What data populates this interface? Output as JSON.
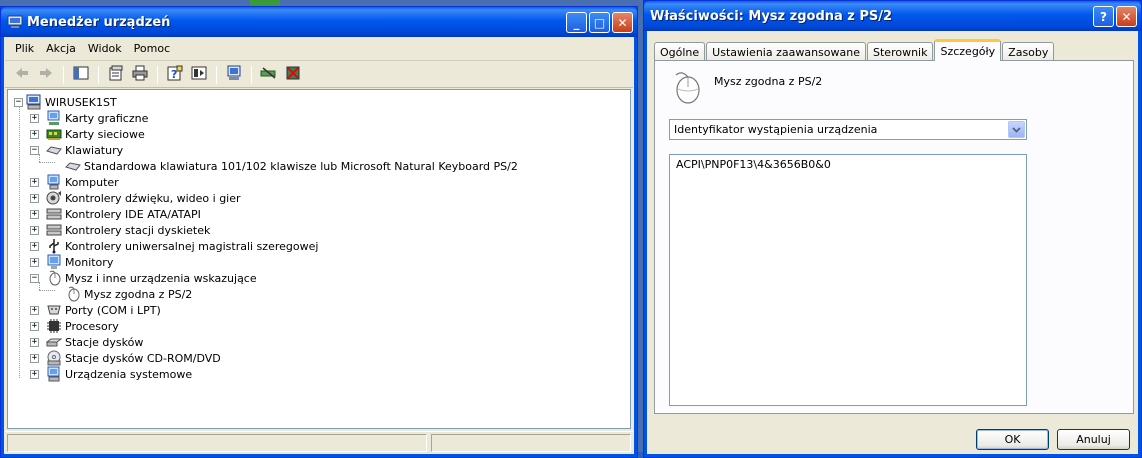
{
  "device_manager": {
    "title": "Menedżer urządzeń",
    "menu": [
      "Plik",
      "Akcja",
      "Widok",
      "Pomoc"
    ],
    "toolbar_icons": [
      "back-icon",
      "forward-icon",
      "up-level-icon",
      "properties-icon",
      "print-icon",
      "help-icon",
      "view-icon",
      "computer-scan-icon",
      "update-driver-icon",
      "uninstall-icon"
    ],
    "tree": {
      "root": "WIRUSEK1ST",
      "categories": [
        {
          "label": "Karty graficzne",
          "icon": "display-adapter-icon",
          "expanded": false
        },
        {
          "label": "Karty sieciowe",
          "icon": "network-adapter-icon",
          "expanded": false
        },
        {
          "label": "Klawiatury",
          "icon": "keyboard-icon",
          "expanded": true,
          "children": [
            "Standardowa klawiatura 101/102 klawisze lub Microsoft Natural Keyboard PS/2"
          ]
        },
        {
          "label": "Komputer",
          "icon": "computer-icon",
          "expanded": false
        },
        {
          "label": "Kontrolery dźwięku, wideo i gier",
          "icon": "sound-icon",
          "expanded": false
        },
        {
          "label": "Kontrolery IDE ATA/ATAPI",
          "icon": "ide-controller-icon",
          "expanded": false
        },
        {
          "label": "Kontrolery stacji dyskietek",
          "icon": "floppy-controller-icon",
          "expanded": false
        },
        {
          "label": "Kontrolery uniwersalnej magistrali szeregowej",
          "icon": "usb-icon",
          "expanded": false
        },
        {
          "label": "Monitory",
          "icon": "monitor-icon",
          "expanded": false
        },
        {
          "label": "Mysz i inne urządzenia wskazujące",
          "icon": "mouse-icon",
          "expanded": true,
          "children": [
            "Mysz zgodna z PS/2"
          ]
        },
        {
          "label": "Porty (COM i LPT)",
          "icon": "port-icon",
          "expanded": false
        },
        {
          "label": "Procesory",
          "icon": "processor-icon",
          "expanded": false
        },
        {
          "label": "Stacje dysków",
          "icon": "disk-drive-icon",
          "expanded": false
        },
        {
          "label": "Stacje dysków CD-ROM/DVD",
          "icon": "cdrom-icon",
          "expanded": false
        },
        {
          "label": "Urządzenia systemowe",
          "icon": "system-device-icon",
          "expanded": false
        }
      ]
    }
  },
  "properties": {
    "title": "Właściwości: Mysz zgodna z PS/2",
    "tabs": [
      "Ogólne",
      "Ustawienia zaawansowane",
      "Sterownik",
      "Szczegóły",
      "Zasoby"
    ],
    "active_tab": "Szczegóły",
    "device_name": "Mysz zgodna z PS/2",
    "property_selected": "Identyfikator wystąpienia urządzenia",
    "property_value": "ACPI\\PNP0F13\\4&3656B0&0",
    "ok_label": "OK",
    "cancel_label": "Anuluj"
  },
  "colors": {
    "titlebar": "#0058ee",
    "window_bg": "#ece9d8",
    "tab_highlight": "#ffc83c",
    "close_button": "#c6401a"
  }
}
